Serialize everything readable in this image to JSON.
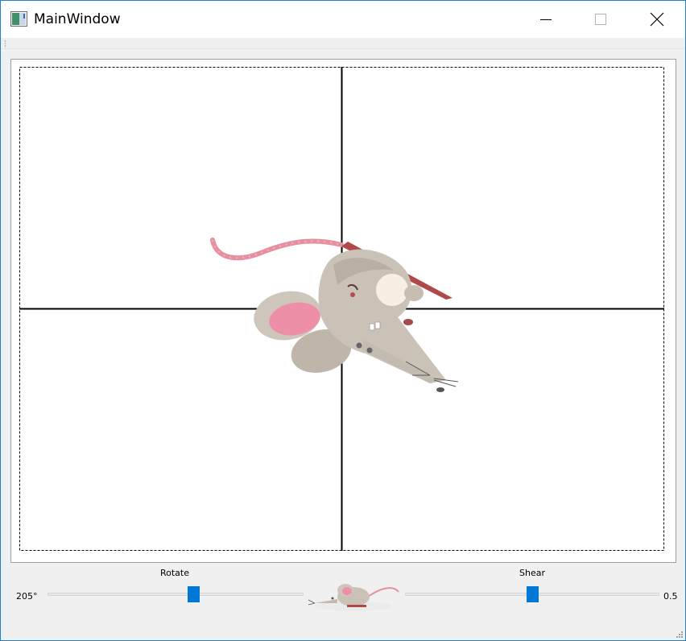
{
  "window": {
    "title": "MainWindow",
    "icons": {
      "app": "app-window-icon",
      "minimize": "minimize-icon",
      "maximize": "maximize-icon",
      "close": "close-icon"
    }
  },
  "scene": {
    "image": "mouse-image",
    "axes": "crosshair-axes",
    "bounds": "dashed-scene-bounds"
  },
  "controls": {
    "rotate": {
      "label": "Rotate",
      "value_text": "205°",
      "fraction": 0.57
    },
    "shear": {
      "label": "Shear",
      "value_text": "0.5",
      "fraction": 0.5
    },
    "thumbnail": "mouse-thumbnail-image"
  },
  "colors": {
    "accent": "#0078d7",
    "window_border": "#1883d7",
    "background": "#f0f0f0"
  }
}
